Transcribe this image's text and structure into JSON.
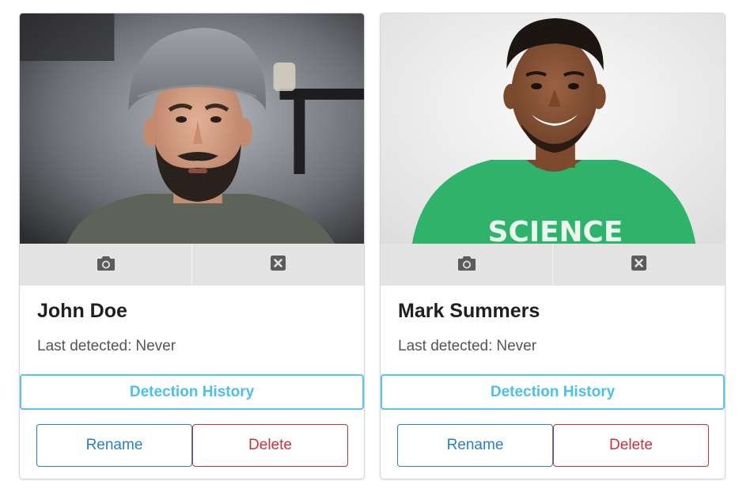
{
  "cards": [
    {
      "name": "John Doe",
      "last_detected_label": "Last detected:",
      "last_detected_value": "Never",
      "history_label": "Detection History",
      "rename_label": "Rename",
      "delete_label": "Delete"
    },
    {
      "name": "Mark Summers",
      "last_detected_label": "Last detected:",
      "last_detected_value": "Never",
      "history_label": "Detection History",
      "rename_label": "Rename",
      "delete_label": "Delete",
      "shirt_text": "SCIENCE"
    }
  ],
  "icons": {
    "photo_action_left": "camera-icon",
    "photo_action_right": "close-box-icon"
  },
  "colors": {
    "history_accent": "#4dbfee",
    "rename_accent": "#2a7fc8",
    "delete_accent": "#c8323c",
    "photo_bar": "#e3e3e3"
  }
}
